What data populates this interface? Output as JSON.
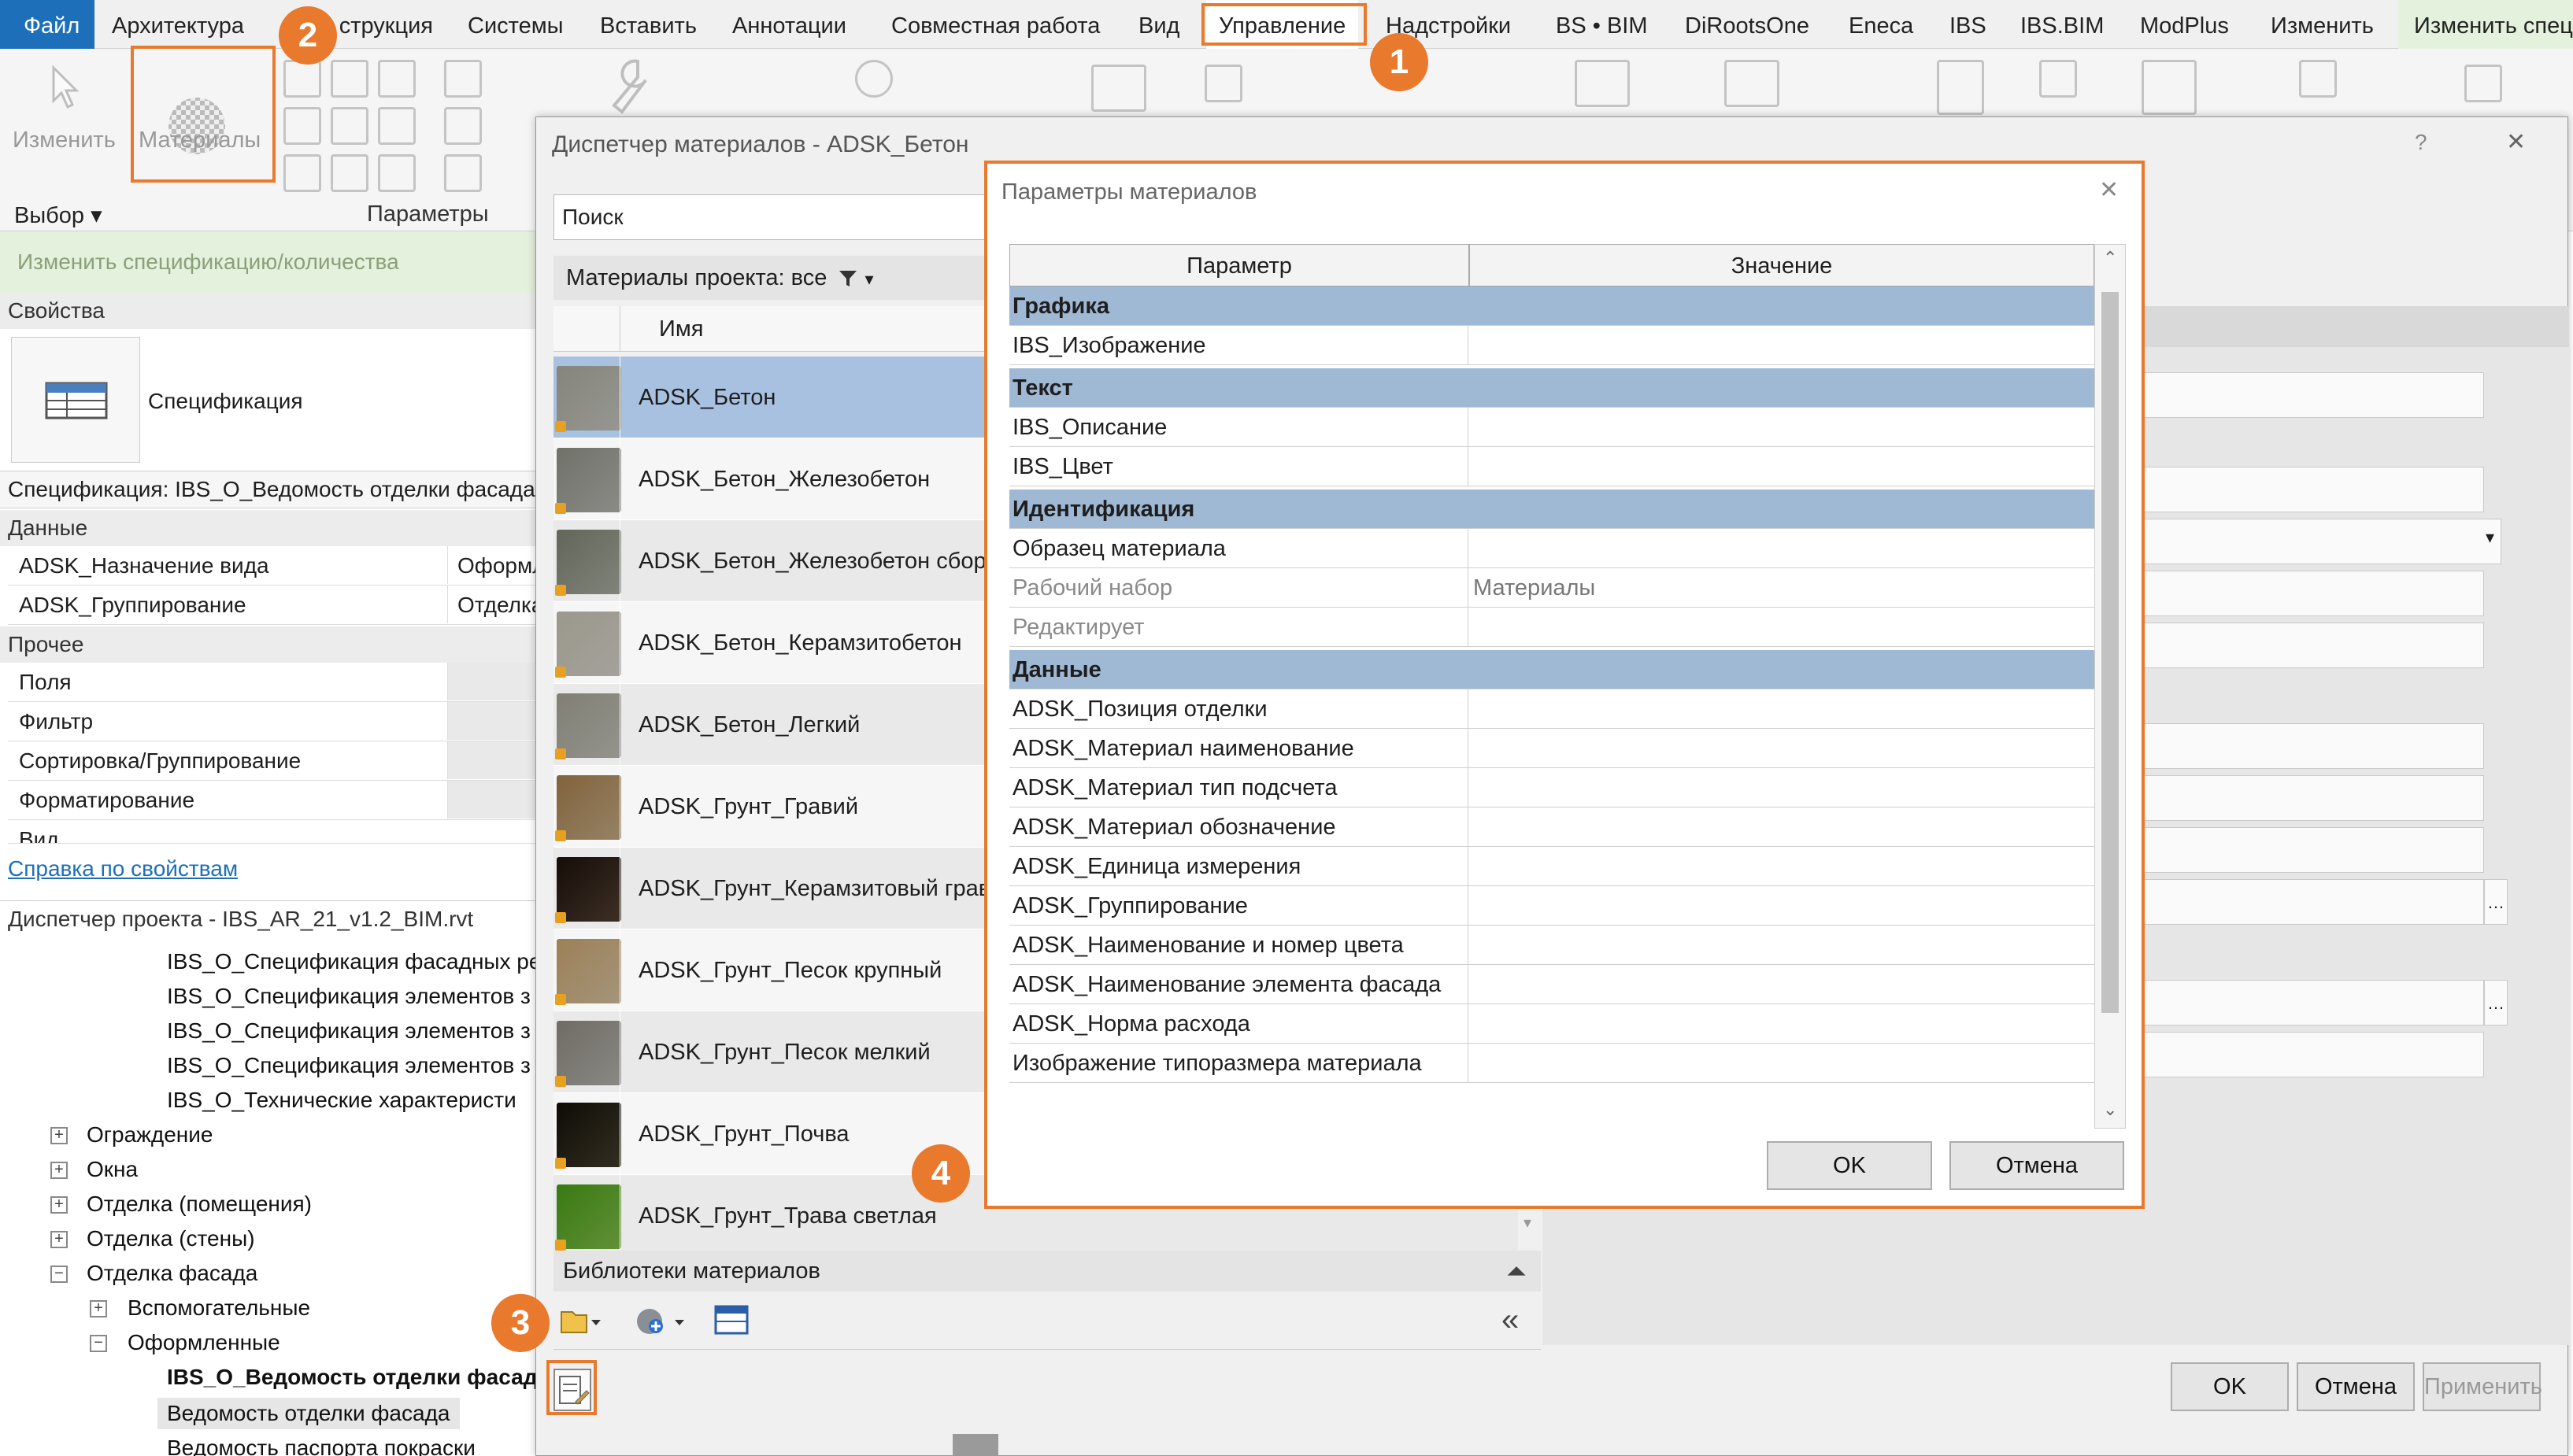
{
  "ribbon": {
    "tabs": [
      "Файл",
      "Архитектура",
      "Конструкция",
      "Системы",
      "Вставить",
      "Аннотации",
      "Совместная работа",
      "Вид",
      "Управление",
      "Надстройки",
      "BS • BIM",
      "DiRootsOne",
      "Eneca",
      "IBS",
      "IBS.BIM",
      "ModPlus",
      "Изменить",
      "Изменить спец"
    ],
    "modify_label": "Изменить",
    "materials_label": "Материалы",
    "select_label": "Выбор",
    "params_label": "Параметры",
    "context_bar": "Изменить спецификацию/количества"
  },
  "properties": {
    "header": "Свойства",
    "type_name": "Спецификация",
    "instance": "Спецификация: IBS_O_Ведомость отделки фасада",
    "section_data": "Данные",
    "section_other": "Прочее",
    "data_rows": [
      {
        "key": "ADSK_Назначение вида",
        "value": "Оформл"
      },
      {
        "key": "ADSK_Группирование",
        "value": "Отделка"
      }
    ],
    "other_rows": [
      "Поля",
      "Фильтр",
      "Сортировка/Группирование",
      "Форматирование",
      "Вид"
    ],
    "help_link": "Справка по свойствам"
  },
  "project_browser": {
    "header": "Диспетчер проекта - IBS_AR_21_v1.2_BIM.rvt",
    "items": [
      "IBS_O_Спецификация фасадных ре",
      "IBS_O_Спецификация элементов з",
      "IBS_O_Спецификация элементов з",
      "IBS_O_Спецификация элементов з",
      "IBS_O_Технические  характеристи",
      "Ограждение",
      "Окна",
      "Отделка (помещения)",
      "Отделка (стены)",
      "Отделка фасада",
      "Вспомогательные",
      "Оформленные",
      "IBS_O_Ведомость отделки фасад",
      "Ведомость отделки фасада",
      "Ведомость паспорта покраски"
    ]
  },
  "material_browser": {
    "title": "Диспетчер материалов - ADSK_Бетон",
    "help": "?",
    "close": "✕",
    "search_placeholder": "Поиск",
    "filter_label": "Материалы проекта: все",
    "col_name": "Имя",
    "materials": [
      {
        "name": "ADSK_Бетон",
        "color": "#b8b8b2"
      },
      {
        "name": "ADSK_Бетон_Железобетон",
        "color": "#a9aaa4"
      },
      {
        "name": "ADSK_Бетон_Железобетон сборн",
        "color": "#9ea196"
      },
      {
        "name": "ADSK_Бетон_Керамзитобетон",
        "color": "#c7c5bd"
      },
      {
        "name": "ADSK_Бетон_Легкий",
        "color": "#b5b4ac"
      },
      {
        "name": "ADSK_Грунт_Гравий",
        "color": "#b69f7c"
      },
      {
        "name": "ADSK_Грунт_Керамзитовый грав",
        "color": "#4a3a2e"
      },
      {
        "name": "ADSK_Грунт_Песок крупный",
        "color": "#c8b595"
      },
      {
        "name": "ADSK_Грунт_Песок мелкий",
        "color": "#a8a6a0"
      },
      {
        "name": "ADSK_Грунт_Почва",
        "color": "#3d3828"
      },
      {
        "name": "ADSK_Грунт_Трава светлая",
        "color": "#78b044"
      }
    ],
    "libraries_label": "Библиотеки материалов",
    "ok": "OK",
    "cancel": "Отмена",
    "apply": "Применить"
  },
  "params_dialog": {
    "title": "Параметры материалов",
    "close": "✕",
    "col_param": "Параметр",
    "col_value": "Значение",
    "rows": [
      {
        "type": "group",
        "key": "Графика"
      },
      {
        "type": "row",
        "key": "IBS_Изображение",
        "value": ""
      },
      {
        "type": "group",
        "key": "Текст"
      },
      {
        "type": "row",
        "key": "IBS_Описание",
        "value": ""
      },
      {
        "type": "row",
        "key": "IBS_Цвет",
        "value": ""
      },
      {
        "type": "group",
        "key": "Идентификация"
      },
      {
        "type": "row",
        "key": "Образец материала",
        "value": ""
      },
      {
        "type": "row",
        "key": "Рабочий набор",
        "value": "Материалы",
        "dim": true
      },
      {
        "type": "row",
        "key": "Редактирует",
        "value": "",
        "dim": true
      },
      {
        "type": "group",
        "key": "Данные"
      },
      {
        "type": "row",
        "key": "ADSK_Позиция отделки",
        "value": ""
      },
      {
        "type": "row",
        "key": "ADSK_Материал наименование",
        "value": ""
      },
      {
        "type": "row",
        "key": "ADSK_Материал тип подсчета",
        "value": ""
      },
      {
        "type": "row",
        "key": "ADSK_Материал обозначение",
        "value": ""
      },
      {
        "type": "row",
        "key": "ADSK_Единица измерения",
        "value": ""
      },
      {
        "type": "row",
        "key": "ADSK_Группирование",
        "value": ""
      },
      {
        "type": "row",
        "key": "ADSK_Наименование и номер цвета",
        "value": ""
      },
      {
        "type": "row",
        "key": "ADSK_Наименование элемента фасада",
        "value": ""
      },
      {
        "type": "row",
        "key": "ADSK_Норма расхода",
        "value": ""
      },
      {
        "type": "row",
        "key": "Изображение типоразмера материала",
        "value": ""
      }
    ],
    "ok": "OK",
    "cancel": "Отмена"
  },
  "badges": [
    "1",
    "2",
    "3",
    "4"
  ],
  "colors": {
    "accent": "#e8792d",
    "selected": "#a8c1e0",
    "group": "#9fb8d4",
    "file_tab": "#1c6fb8",
    "ctx": "#e4f1dc"
  }
}
